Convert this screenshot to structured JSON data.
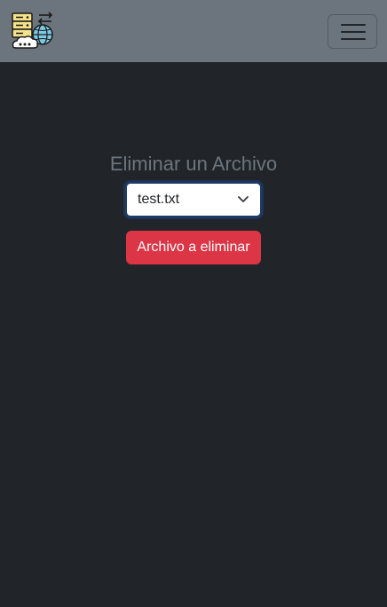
{
  "navbar": {
    "logo_icon": "server-cloud-globe-icon",
    "toggler_icon": "hamburger-menu-icon"
  },
  "main": {
    "title": "Eliminar un Archivo",
    "file_select": {
      "selected": "test.txt",
      "icon": "chevron-down-icon"
    },
    "delete_button_label": "Archivo a eliminar"
  },
  "colors": {
    "page_background": "#212529",
    "navbar_background": "#6c757d",
    "title_text": "#6c757d",
    "danger": "#dc3545",
    "focus_ring": "#1f3c68"
  }
}
